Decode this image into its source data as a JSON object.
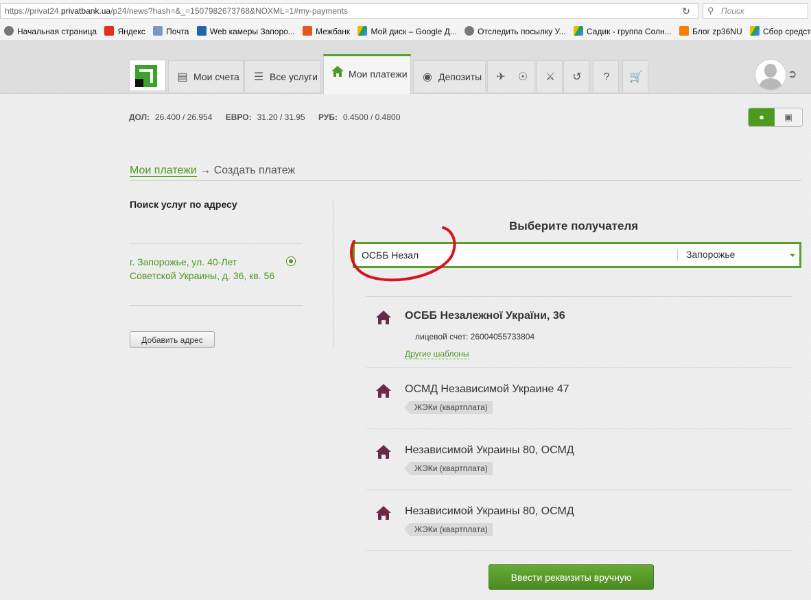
{
  "browser": {
    "url_prefix": "https://privat24.",
    "url_host": "privatbank.ua",
    "url_rest": "/p24/news?hash=&_=1507982673768&NOXML=1#my-payments",
    "search_placeholder": "Поиск",
    "bookmarks": [
      {
        "label": "Начальная страница",
        "icon": "globe-icon",
        "color": "#666666"
      },
      {
        "label": "Яндекс",
        "icon": "yandex-icon",
        "color": "#e0301e"
      },
      {
        "label": "Почта",
        "icon": "mail-icon",
        "color": "#5a7fb5"
      },
      {
        "label": "Web камеры Запоро...",
        "icon": "webcam-icon",
        "color": "#2266aa"
      },
      {
        "label": "Межбанк",
        "icon": "mezhbank-icon",
        "color": "#e05a1e"
      },
      {
        "label": "Мой диск – Google Д...",
        "icon": "drive-icon",
        "color": "#f2b900"
      },
      {
        "label": "Отследить посылку У...",
        "icon": "globe-icon",
        "color": "#666666"
      },
      {
        "label": "Садик - группа Солн...",
        "icon": "drive-icon",
        "color": "#f2b900"
      },
      {
        "label": "Блог zp36NU",
        "icon": "blogger-icon",
        "color": "#f57d00"
      },
      {
        "label": "Сбор средств",
        "icon": "drive-icon",
        "color": "#f2b900"
      }
    ]
  },
  "nav": {
    "tabs": [
      {
        "label": "Мои счета",
        "icon": "card-icon"
      },
      {
        "label": "Все услуги",
        "icon": "list-icon"
      },
      {
        "label": "Мои платежи",
        "icon": "home-icon"
      },
      {
        "label": "Депозиты",
        "icon": "piggy-bank-icon"
      }
    ],
    "small_tabs": [
      "travel-icon",
      "globe-icon",
      "coat-of-arms-icon",
      "history-icon",
      "help-icon",
      "cart-icon"
    ]
  },
  "rates": [
    {
      "label": "ДОЛ:",
      "value": "26.400 / 26.954"
    },
    {
      "label": "ЕВРО:",
      "value": "31.20 / 31.95"
    },
    {
      "label": "РУБ:",
      "value": "0.4500 / 0.4800"
    }
  ],
  "breadcrumb": {
    "parent": "Мои платежи",
    "arrow": "→",
    "current": "Создать платеж"
  },
  "left": {
    "title": "Поиск услуг по адресу",
    "address": "г. Запорожье, ул. 40-Лет Советской Украины, д. 36, кв. 56",
    "add_button": "Добавить адрес"
  },
  "right": {
    "title": "Выберите получателя",
    "search_value": "ОСББ Незал",
    "city": "Запорожье"
  },
  "results": [
    {
      "title": "ОСББ Незалежної України, 36",
      "account_label": "лицевой счет:",
      "account": "26004055733804",
      "other": "Другие шаблоны"
    },
    {
      "title": "ОСМД Независимой Украине 47",
      "tag": "ЖЭКи (квартплата)"
    },
    {
      "title": "Независимой Украины 80, ОСМД",
      "tag": "ЖЭКи (квартплата)"
    },
    {
      "title": "Независимой Украины 80, ОСМД",
      "tag": "ЖЭКи (квартплата)"
    }
  ],
  "manual_button": "Ввести реквизиты вручную",
  "colors": {
    "accent": "#4c9a1e",
    "annotation": "#d9141b",
    "house": "#6b2a4a"
  }
}
